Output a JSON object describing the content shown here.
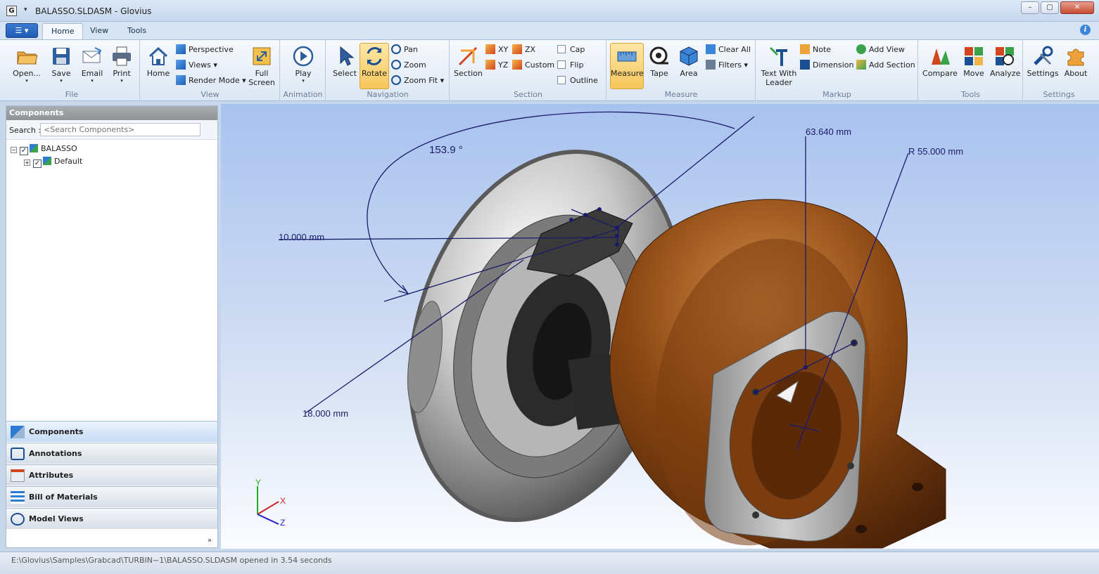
{
  "window": {
    "title": "BALASSO.SLDASM - Glovius",
    "app_icon": "G"
  },
  "tabs": [
    {
      "label": "Home"
    },
    {
      "label": "View"
    },
    {
      "label": "Tools"
    }
  ],
  "ribbon": {
    "file": {
      "label": "File",
      "open": "Open...",
      "save": "Save",
      "email": "Email",
      "print": "Print"
    },
    "view": {
      "label": "View",
      "home": "Home",
      "perspective": "Perspective",
      "views": "Views",
      "render_mode": "Render Mode",
      "full_screen_1": "Full",
      "full_screen_2": "Screen"
    },
    "animation": {
      "label": "Animation",
      "play": "Play"
    },
    "navigation": {
      "label": "Navigation",
      "select": "Select",
      "rotate": "Rotate",
      "pan": "Pan",
      "zoom": "Zoom",
      "zoom_fit": "Zoom Fit"
    },
    "section": {
      "label": "Section",
      "section": "Section",
      "xy": "XY",
      "zx": "ZX",
      "yz": "YZ",
      "custom": "Custom",
      "cap": "Cap",
      "flip": "Flip",
      "outline": "Outline"
    },
    "measure": {
      "label": "Measure",
      "measure": "Measure",
      "tape": "Tape",
      "area": "Area",
      "clear_all": "Clear All",
      "filters": "Filters"
    },
    "markup": {
      "label": "Markup",
      "text_with_leader_1": "Text With",
      "text_with_leader_2": "Leader",
      "note": "Note",
      "dimension": "Dimension",
      "add_view": "Add View",
      "add_section": "Add Section"
    },
    "tools": {
      "label": "Tools",
      "compare": "Compare",
      "move": "Move",
      "analyze": "Analyze"
    },
    "settings": {
      "label": "Settings",
      "settings": "Settings",
      "about": "About"
    }
  },
  "components_panel": {
    "header": "Components",
    "search_label": "Search :",
    "search_placeholder": "<Search Components>",
    "tree": [
      {
        "label": "BALASSO",
        "level": 0
      },
      {
        "label": "Default",
        "level": 1
      }
    ]
  },
  "nav_panels": [
    {
      "label": "Components"
    },
    {
      "label": "Annotations"
    },
    {
      "label": "Attributes"
    },
    {
      "label": "Bill of Materials"
    },
    {
      "label": "Model Views"
    }
  ],
  "viewport": {
    "annotations": {
      "angle": "153.9 °",
      "dim1": "10.000 mm",
      "dim2": "18.000 mm",
      "dim3": "63.640 mm",
      "radius": "R 55.000 mm"
    },
    "axes": {
      "x": "X",
      "y": "Y",
      "z": "Z"
    }
  },
  "status": {
    "text": "E:\\Glovius\\Samples\\Grabcad\\TURBIN~1\\BALASSO.SLDASM opened in 3.54 seconds"
  },
  "colors": {
    "selected_tool": "#f7c65b",
    "model_copper": "#8a4712",
    "model_steel": "#b9b9b9",
    "dimension_line": "#1a1a6a"
  }
}
